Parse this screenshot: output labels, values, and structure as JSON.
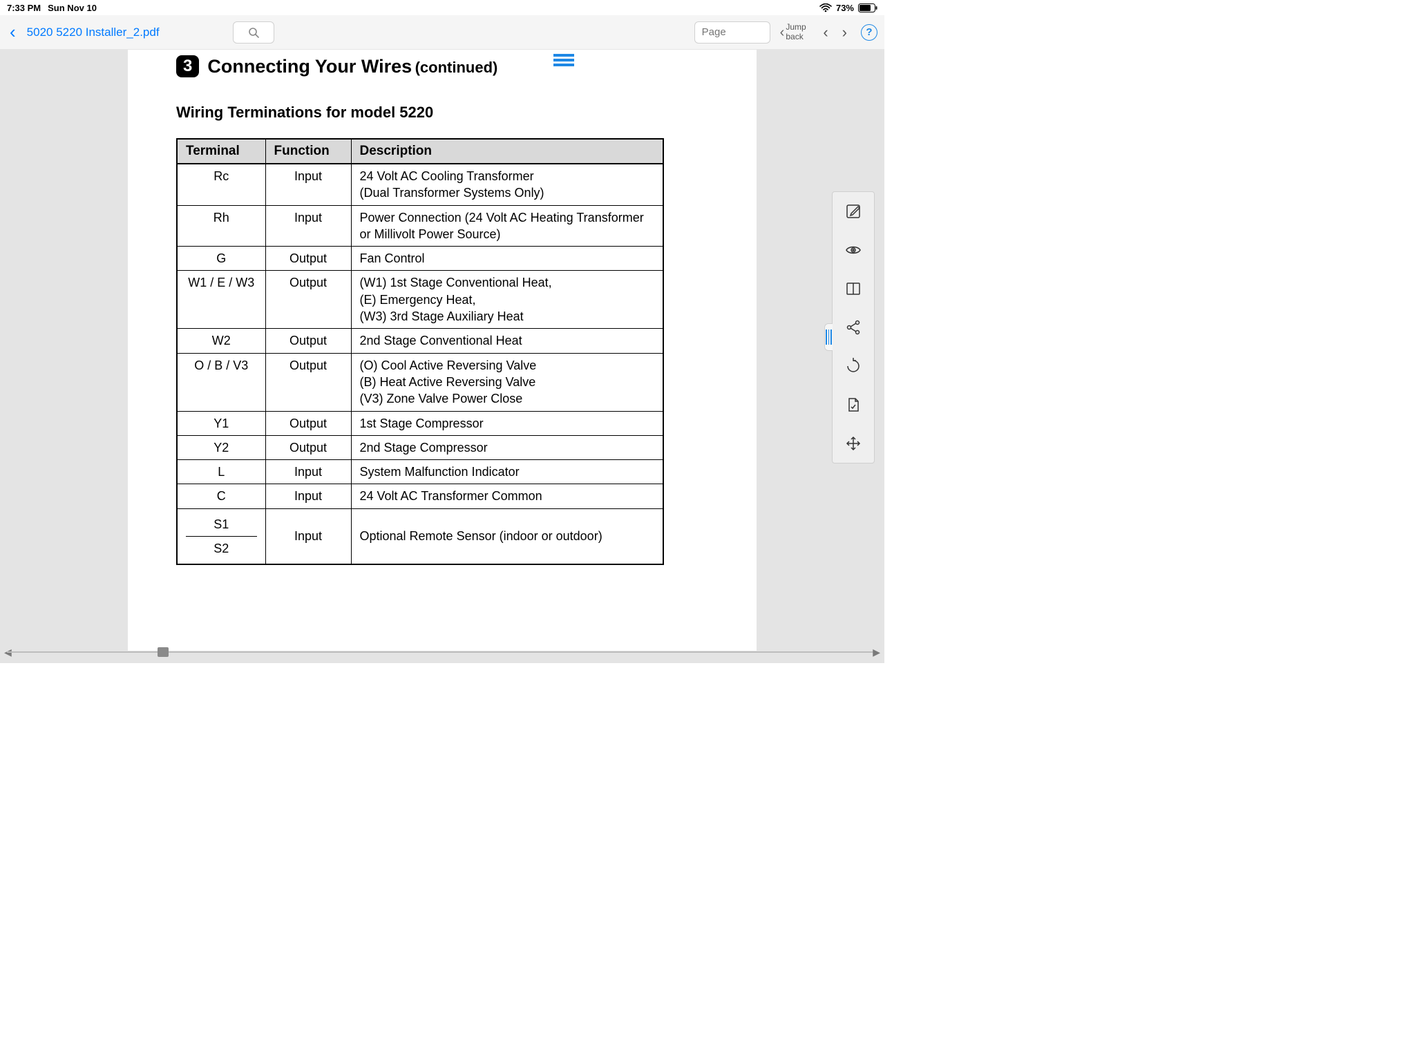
{
  "status": {
    "time": "7:33 PM",
    "date": "Sun Nov 10",
    "battery": "73%"
  },
  "toolbar": {
    "doc_title": "5020 5220 Installer_2.pdf",
    "page_placeholder": "Page",
    "jump_back": "Jump back",
    "help": "?"
  },
  "section": {
    "number": "3",
    "title": "Connecting Your Wires",
    "continued": "(continued)"
  },
  "subtitle": "Wiring Terminations for model 5220",
  "table": {
    "headers": {
      "terminal": "Terminal",
      "function": "Function",
      "description": "Description"
    },
    "rows": [
      {
        "terminal": "Rc",
        "function": "Input",
        "description": "24 Volt AC Cooling Transformer\n(Dual Transformer Systems Only)"
      },
      {
        "terminal": "Rh",
        "function": "Input",
        "description": "Power Connection (24 Volt AC Heating Transformer or Millivolt Power Source)"
      },
      {
        "terminal": "G",
        "function": "Output",
        "description": "Fan Control"
      },
      {
        "terminal": "W1 / E / W3",
        "function": "Output",
        "description": "(W1) 1st Stage Conventional Heat,\n(E) Emergency Heat,\n(W3) 3rd Stage Auxiliary Heat"
      },
      {
        "terminal": "W2",
        "function": "Output",
        "description": "2nd Stage Conventional Heat"
      },
      {
        "terminal": "O / B / V3",
        "function": "Output",
        "description": "(O) Cool Active Reversing Valve\n(B) Heat Active Reversing Valve\n(V3) Zone Valve Power Close"
      },
      {
        "terminal": "Y1",
        "function": "Output",
        "description": "1st Stage Compressor"
      },
      {
        "terminal": "Y2",
        "function": "Output",
        "description": "2nd Stage Compressor"
      },
      {
        "terminal": "L",
        "function": "Input",
        "description": "System Malfunction Indicator"
      },
      {
        "terminal": "C",
        "function": "Input",
        "description": "24 Volt AC Transformer Common"
      }
    ],
    "split_row": {
      "terminal_a": "S1",
      "terminal_b": "S2",
      "function": "Input",
      "description": "Optional Remote Sensor (indoor or outdoor)"
    }
  }
}
